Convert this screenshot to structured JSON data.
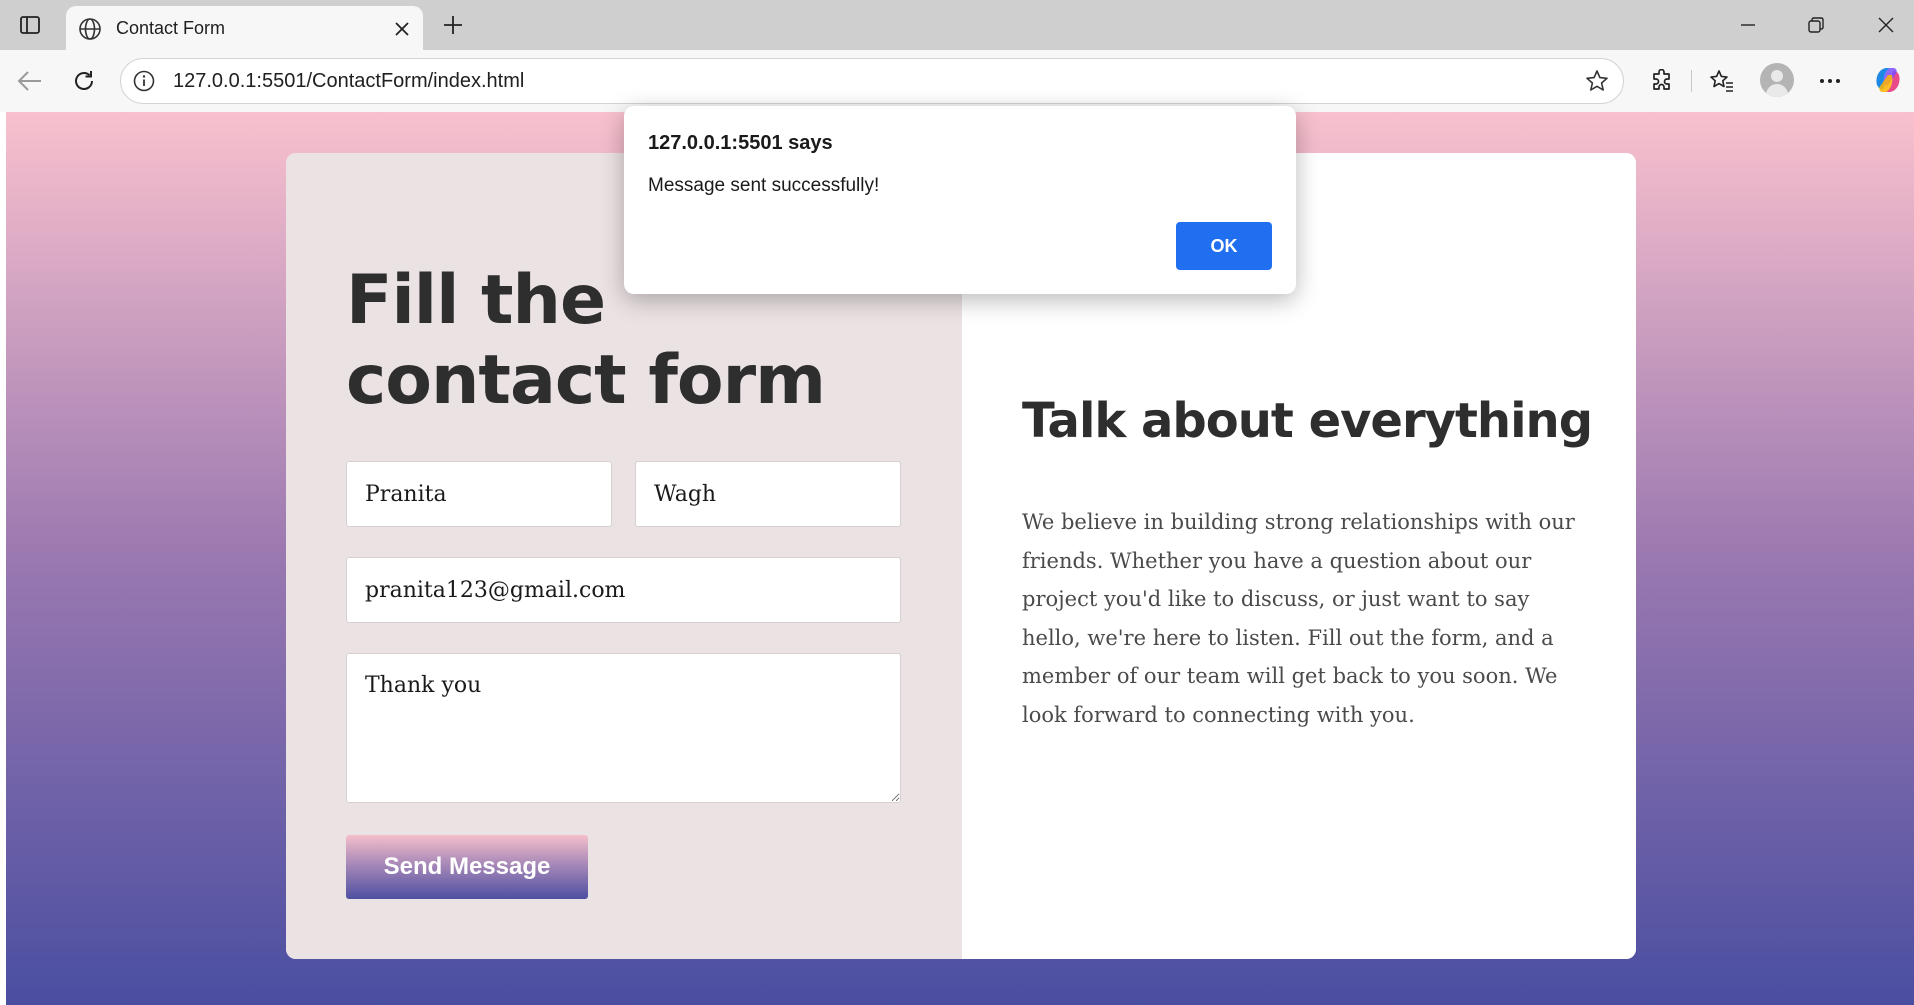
{
  "browser": {
    "tab_title": "Contact Form",
    "url": "127.0.0.1:5501/ContactForm/index.html"
  },
  "form": {
    "title": "Fill the contact form",
    "first_name": "Pranita",
    "last_name": "Wagh",
    "email": "pranita123@gmail.com",
    "message": "Thank you",
    "send_label": "Send Message"
  },
  "info": {
    "title": "Talk about everything",
    "body": "We believe in building strong relationships with our friends. Whether you have a question about our project you'd like to discuss, or just want to say hello, we're here to listen. Fill out the form, and a member of our team will get back to you soon. We look forward to connecting with you."
  },
  "alert": {
    "title": "127.0.0.1:5501 says",
    "message": "Message sent successfully!",
    "ok_label": "OK"
  },
  "colors": {
    "gradient_top": "#f9c1ce",
    "gradient_bottom": "#4a4ea1",
    "left_panel": "#ebe2e3",
    "ok_button": "#1f6ff0"
  },
  "icons": [
    "tab-actions-icon",
    "globe-icon",
    "close-icon",
    "plus-icon",
    "minimize-icon",
    "restore-icon",
    "back-icon",
    "refresh-icon",
    "info-icon",
    "star-icon",
    "extensions-icon",
    "favorites-icon",
    "more-icon",
    "copilot-icon"
  ]
}
